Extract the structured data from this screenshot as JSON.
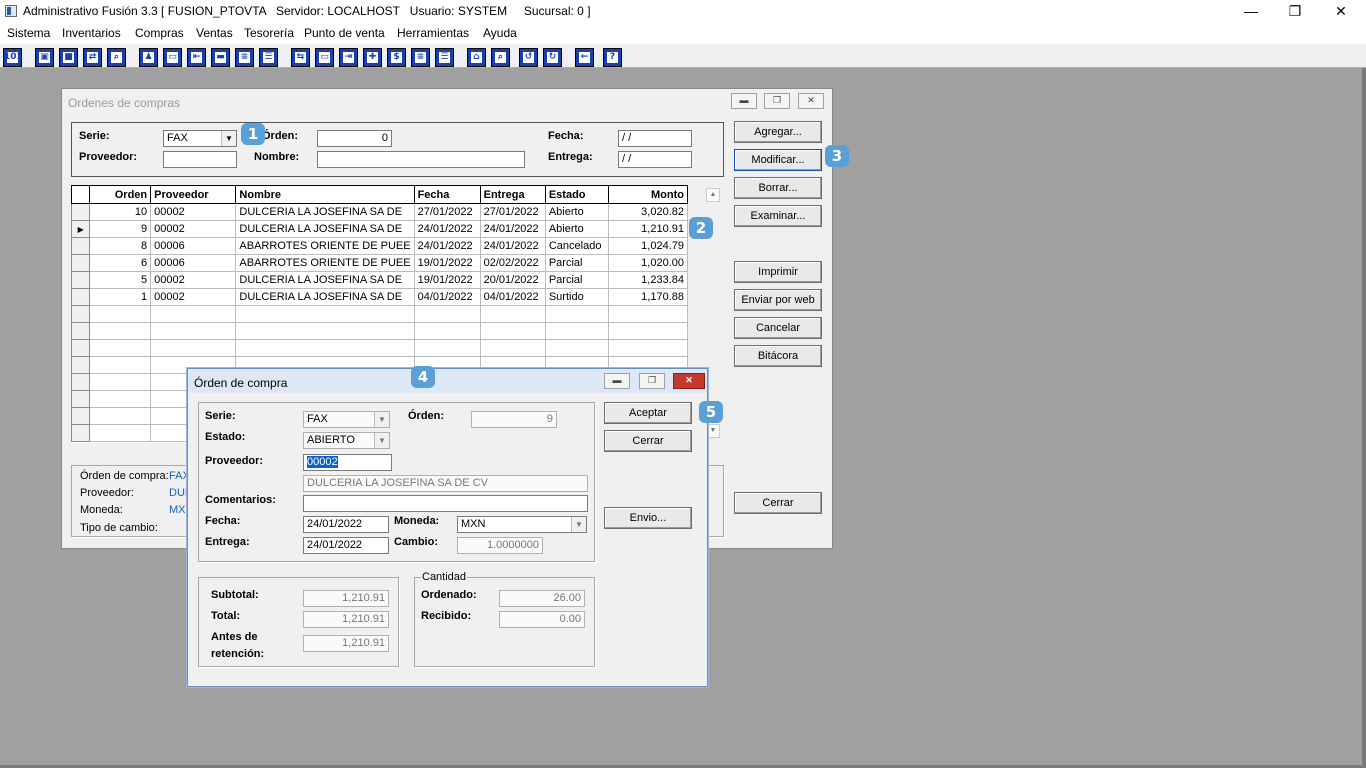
{
  "window": {
    "title": "Administrativo Fusión 3.3 [ FUSION_PTOVTA   Servidor: LOCALHOST   Usuario: SYSTEM     Sucursal: 0 ]",
    "minimize": "—",
    "restore": "❐",
    "close": "✕"
  },
  "menu": [
    "Sistema",
    "Inventarios",
    "Compras",
    "Ventas",
    "Tesorería",
    "Punto de venta",
    "Herramientas",
    "Ayuda"
  ],
  "toolbar": [
    "101",
    "▣",
    "■",
    "⇄",
    "⌕",
    "♟",
    "▭",
    "⇤",
    "▬",
    "≡",
    "☰",
    "⇆",
    "▭",
    "⇥",
    "✚",
    "$",
    "≡",
    "☰",
    "⌂",
    "⌕",
    "↺",
    "↻",
    "←",
    "?"
  ],
  "orders_window": {
    "title": "Ordenes de compras",
    "filters": {
      "serie_label": "Serie:",
      "serie_value": "FAX",
      "orden_label": "Órden:",
      "orden_value": "0",
      "fecha_label": "Fecha:",
      "fecha_value": "/ /",
      "proveedor_label": "Proveedor:",
      "proveedor_value": "",
      "nombre_label": "Nombre:",
      "nombre_value": "",
      "entrega_label": "Entrega:",
      "entrega_value": "/ /"
    },
    "columns": [
      "Orden",
      "Proveedor",
      "Nombre",
      "Fecha",
      "Entrega",
      "Estado",
      "Monto"
    ],
    "rows": [
      {
        "marker": "",
        "orden": "10",
        "proveedor": "00002",
        "nombre": "DULCERIA LA JOSEFINA SA DE",
        "fecha": "27/01/2022",
        "entrega": "27/01/2022",
        "estado": "Abierto",
        "monto": "3,020.82"
      },
      {
        "marker": "▶",
        "orden": "9",
        "proveedor": "00002",
        "nombre": "DULCERIA LA JOSEFINA SA DE",
        "fecha": "24/01/2022",
        "entrega": "24/01/2022",
        "estado": "Abierto",
        "monto": "1,210.91"
      },
      {
        "marker": "",
        "orden": "8",
        "proveedor": "00006",
        "nombre": "ABARROTES ORIENTE DE PUEE",
        "fecha": "24/01/2022",
        "entrega": "24/01/2022",
        "estado": "Cancelado",
        "monto": "1,024.79"
      },
      {
        "marker": "",
        "orden": "6",
        "proveedor": "00006",
        "nombre": "ABARROTES ORIENTE DE PUEE",
        "fecha": "19/01/2022",
        "entrega": "02/02/2022",
        "estado": "Parcial",
        "monto": "1,020.00"
      },
      {
        "marker": "",
        "orden": "5",
        "proveedor": "00002",
        "nombre": "DULCERIA LA JOSEFINA SA DE",
        "fecha": "19/01/2022",
        "entrega": "20/01/2022",
        "estado": "Parcial",
        "monto": "1,233.84"
      },
      {
        "marker": "",
        "orden": "1",
        "proveedor": "00002",
        "nombre": "DULCERIA LA JOSEFINA SA DE",
        "fecha": "04/01/2022",
        "entrega": "04/01/2022",
        "estado": "Surtido",
        "monto": "1,170.88"
      }
    ],
    "empty_rows": 8,
    "buttons": [
      "Agregar...",
      "Modificar...",
      "Borrar...",
      "Examinar...",
      "Imprimir",
      "Enviar por web",
      "Cancelar",
      "Bitácora",
      "Cerrar"
    ],
    "info": {
      "orden_label": "Órden de compra:",
      "orden_value": "FAX",
      "proveedor_label": "Proveedor:",
      "proveedor_value": "DUL",
      "moneda_label": "Moneda:",
      "moneda_value": "MXN",
      "tipo_label": "Tipo de cambio:"
    }
  },
  "badges": [
    "1",
    "2",
    "3",
    "4",
    "5"
  ],
  "order_dialog": {
    "title": "Órden de compra",
    "serie_label": "Serie:",
    "serie_value": "FAX",
    "orden_label": "Órden:",
    "orden_value": "9",
    "estado_label": "Estado:",
    "estado_value": "ABIERTO",
    "proveedor_label": "Proveedor:",
    "proveedor_value": "00002",
    "proveedor_nombre": "DULCERIA LA JOSEFINA SA DE CV",
    "comentarios_label": "Comentarios:",
    "comentarios_value": "",
    "fecha_label": "Fecha:",
    "fecha_value": "24/01/2022",
    "moneda_label": "Moneda:",
    "moneda_value": "MXN",
    "entrega_label": "Entrega:",
    "entrega_value": "24/01/2022",
    "cambio_label": "Cambio:",
    "cambio_value": "1.0000000",
    "subtotal_label": "Subtotal:",
    "subtotal_value": "1,210.91",
    "total_label": "Total:",
    "total_value": "1,210.91",
    "antes_label_1": "Antes de",
    "antes_label_2": "retención:",
    "antes_value": "1,210.91",
    "cantidad_label": "Cantidad",
    "ordenado_label": "Ordenado:",
    "ordenado_value": "26.00",
    "recibido_label": "Recibido:",
    "recibido_value": "0.00",
    "aceptar": "Aceptar",
    "cerrar": "Cerrar",
    "envio": "Envio..."
  }
}
